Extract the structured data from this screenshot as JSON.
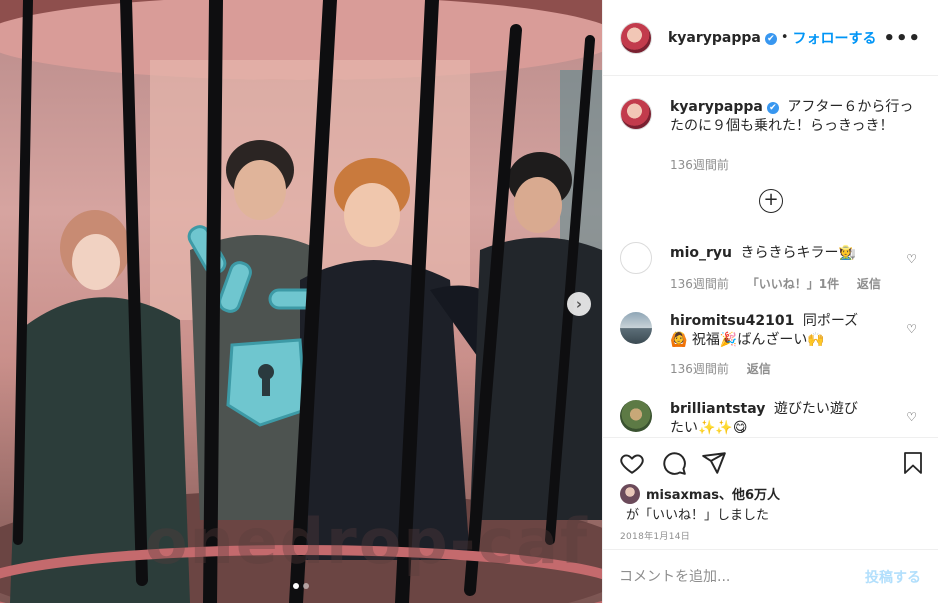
{
  "photo": {
    "watermark": "onedrop-caf",
    "next_arrow": "›",
    "carousel_count": 2,
    "carousel_active": 0
  },
  "header": {
    "username": "kyarypappa",
    "verified_mark": "✔",
    "separator": "•",
    "follow_label": "フォローする",
    "more_label": "•••"
  },
  "caption": {
    "username": "kyarypappa",
    "text": "アフター６から行ったのに９個も乗れた！らっきっき！",
    "time": "136週間前"
  },
  "load_more_icon": "plus-circle-icon",
  "comments": [
    {
      "username": "mio_ryu",
      "text": "きらきらキラー🧑‍🌾",
      "time": "136週間前",
      "likes": "「いいね！」1件",
      "reply": "返信"
    },
    {
      "username": "hiromitsu42101",
      "text": "同ポーズ🙆 祝福🎉ばんざーい🙌",
      "time": "136週間前",
      "reply": "返信"
    },
    {
      "username": "brilliantstay",
      "text": "遊びたい遊びたい✨✨😋"
    }
  ],
  "likes": {
    "users": "misaxmas、他6万人",
    "suffix": "が「いいね！」しました"
  },
  "date": "2018年1月14日",
  "add_comment": {
    "placeholder": "コメントを追加...",
    "post_label": "投稿する"
  },
  "colors": {
    "accent": "#0095f6",
    "post_disabled": "#b2dffc",
    "meta": "#8e8e8e"
  }
}
